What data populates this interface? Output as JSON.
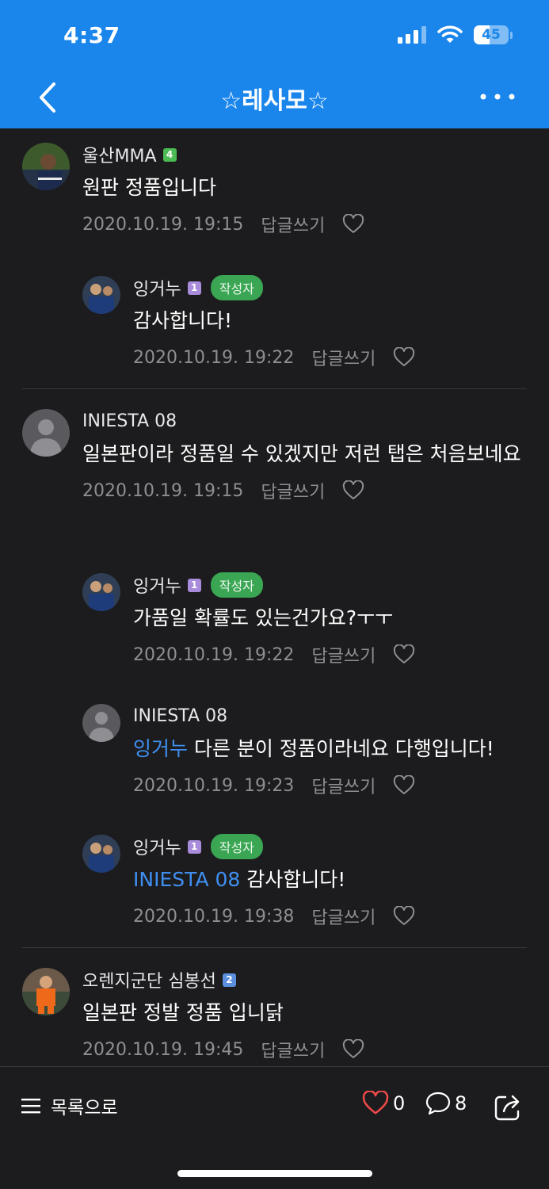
{
  "status_bar": {
    "time": "4:37",
    "battery": "45",
    "battery_level": 0.45
  },
  "header": {
    "title": "☆레사모☆"
  },
  "comments": [
    {
      "author": "울산MMA",
      "level": "4",
      "text": "원판 정품입니다",
      "date": "2020.10.19. 19:15",
      "reply_label": "답글쓰기",
      "replies": [
        {
          "author": "잉거누",
          "level": "1",
          "badge": "작성자",
          "text": "감사합니다!",
          "date": "2020.10.19. 19:22",
          "reply_label": "답글쓰기"
        }
      ]
    },
    {
      "author": "INIESTA 08",
      "text": "일본판이라 정품일 수 있겠지만 저런 탭은 처음보네요",
      "date": "2020.10.19. 19:15",
      "reply_label": "답글쓰기",
      "replies": [
        {
          "author": "잉거누",
          "level": "1",
          "badge": "작성자",
          "text": "가품일 확률도 있는건가요?ㅜㅜ",
          "date": "2020.10.19. 19:22",
          "reply_label": "답글쓰기"
        },
        {
          "author": "INIESTA 08",
          "mention": "잉거누",
          "text": "다른 분이 정품이라네요 다행입니다!",
          "date": "2020.10.19. 19:23",
          "reply_label": "답글쓰기"
        },
        {
          "author": "잉거누",
          "level": "1",
          "badge": "작성자",
          "mention": "INIESTA 08",
          "text": "감사합니다!",
          "date": "2020.10.19. 19:38",
          "reply_label": "답글쓰기"
        }
      ]
    },
    {
      "author": "오렌지군단 심봉선",
      "level": "2",
      "text": "일본판 정발 정품 입니닭",
      "date": "2020.10.19. 19:45",
      "reply_label": "답글쓰기"
    }
  ],
  "bottom_bar": {
    "list_label": "목록으로",
    "like_count": "0",
    "comment_count": "8"
  },
  "colors": {
    "header": "#1a86ec",
    "background": "#1c1c1e",
    "mention": "#3f8ff0",
    "author_badge": "#3aa552"
  }
}
